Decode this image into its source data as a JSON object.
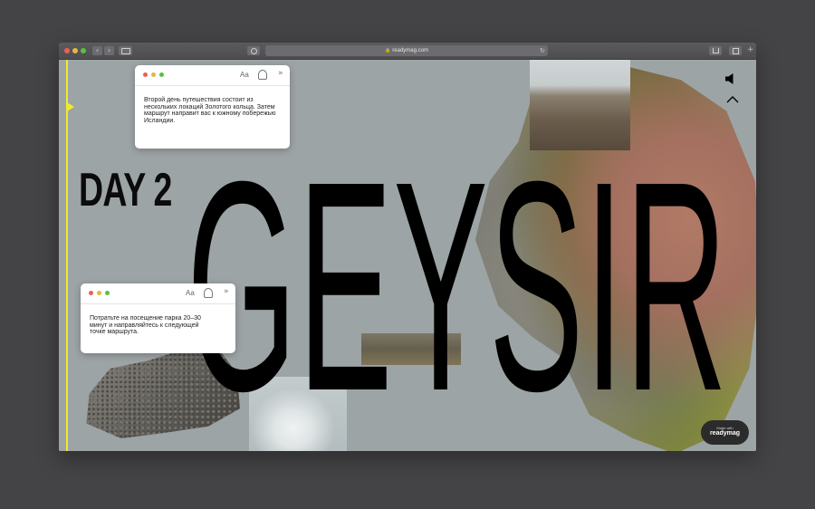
{
  "browser": {
    "url": "readymag.com",
    "back_glyph": "‹",
    "forward_glyph": "›",
    "new_tab_glyph": "+",
    "reload_glyph": "↻",
    "lock_glyph": "🔒"
  },
  "hero": {
    "day_label": "DAY 2",
    "title": "GEYSIR"
  },
  "windows": [
    {
      "font_label": "Aa",
      "expand_glyph": "»",
      "text": "Второй день путешествия состоит из нескольких локаций Золотого кольца. Затем маршрут направит вас к южному побережью Исландии."
    },
    {
      "font_label": "Aa",
      "expand_glyph": "»",
      "text": "Потратьте на посещение парка 20–30 минут и направляйтесь к следующей точке маршрута."
    }
  ],
  "badge": {
    "prefix": "Made with",
    "brand": "readymag"
  },
  "colors": {
    "accent_yellow": "#f1ea2b",
    "page_background": "#9da4a6",
    "title_color": "#000000"
  },
  "icons": [
    "lock-icon",
    "reload-icon",
    "sidebar-icon",
    "privacy-icon",
    "share-icon",
    "tabs-icon",
    "sound-icon",
    "chevron-up-icon",
    "accessibility-icon",
    "expand-icon"
  ]
}
